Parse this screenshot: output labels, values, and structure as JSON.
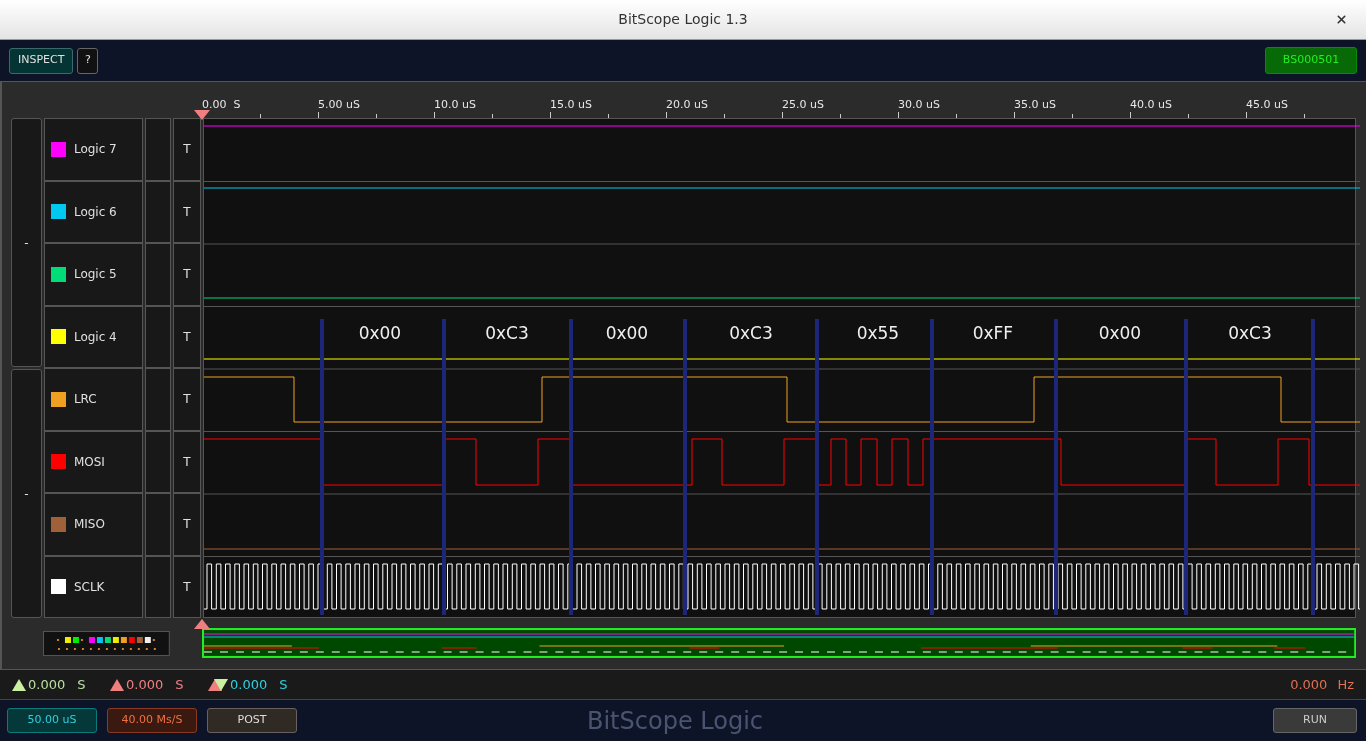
{
  "window": {
    "title": "BitScope Logic 1.3"
  },
  "toolbar": {
    "inspect": "INSPECT",
    "help": "?",
    "device": "BS000501"
  },
  "ruler": [
    "0.00  S",
    "5.00 uS",
    "10.0 uS",
    "15.0 uS",
    "20.0 uS",
    "25.0 uS",
    "30.0 uS",
    "35.0 uS",
    "40.0 uS",
    "45.0 uS"
  ],
  "groups": [
    {
      "label": "-"
    },
    {
      "label": "-"
    }
  ],
  "channels": [
    {
      "name": "Logic 7",
      "color": "#ff00ff",
      "trigger": "T"
    },
    {
      "name": "Logic 6",
      "color": "#00c8f0",
      "trigger": "T"
    },
    {
      "name": "Logic 5",
      "color": "#00dc78",
      "trigger": "T"
    },
    {
      "name": "Logic 4",
      "color": "#ffff00",
      "trigger": "T"
    },
    {
      "name": "LRC",
      "color": "#f0a020",
      "trigger": "T"
    },
    {
      "name": "MOSI",
      "color": "#ff0000",
      "trigger": "T"
    },
    {
      "name": "MISO",
      "color": "#a0603a",
      "trigger": "T"
    },
    {
      "name": "SCLK",
      "color": "#ffffff",
      "trigger": "T"
    }
  ],
  "decodes": [
    "0x00",
    "0xC3",
    "0x00",
    "0xC3",
    "0x55",
    "0xFF",
    "0x00",
    "0xC3"
  ],
  "status": {
    "cursors": [
      {
        "kind": "rise",
        "value": "0.000",
        "unit": "S"
      },
      {
        "kind": "fall",
        "value": "0.000",
        "unit": "S"
      },
      {
        "kind": "delta",
        "value": "0.000",
        "unit": "S"
      }
    ],
    "frequency": {
      "value": "0.000",
      "unit": "Hz"
    }
  },
  "bottom": {
    "timebase": "50.00 uS",
    "rate": "40.00 Ms/S",
    "mode": "POST",
    "brand": "BitScope Logic",
    "run": "RUN"
  }
}
